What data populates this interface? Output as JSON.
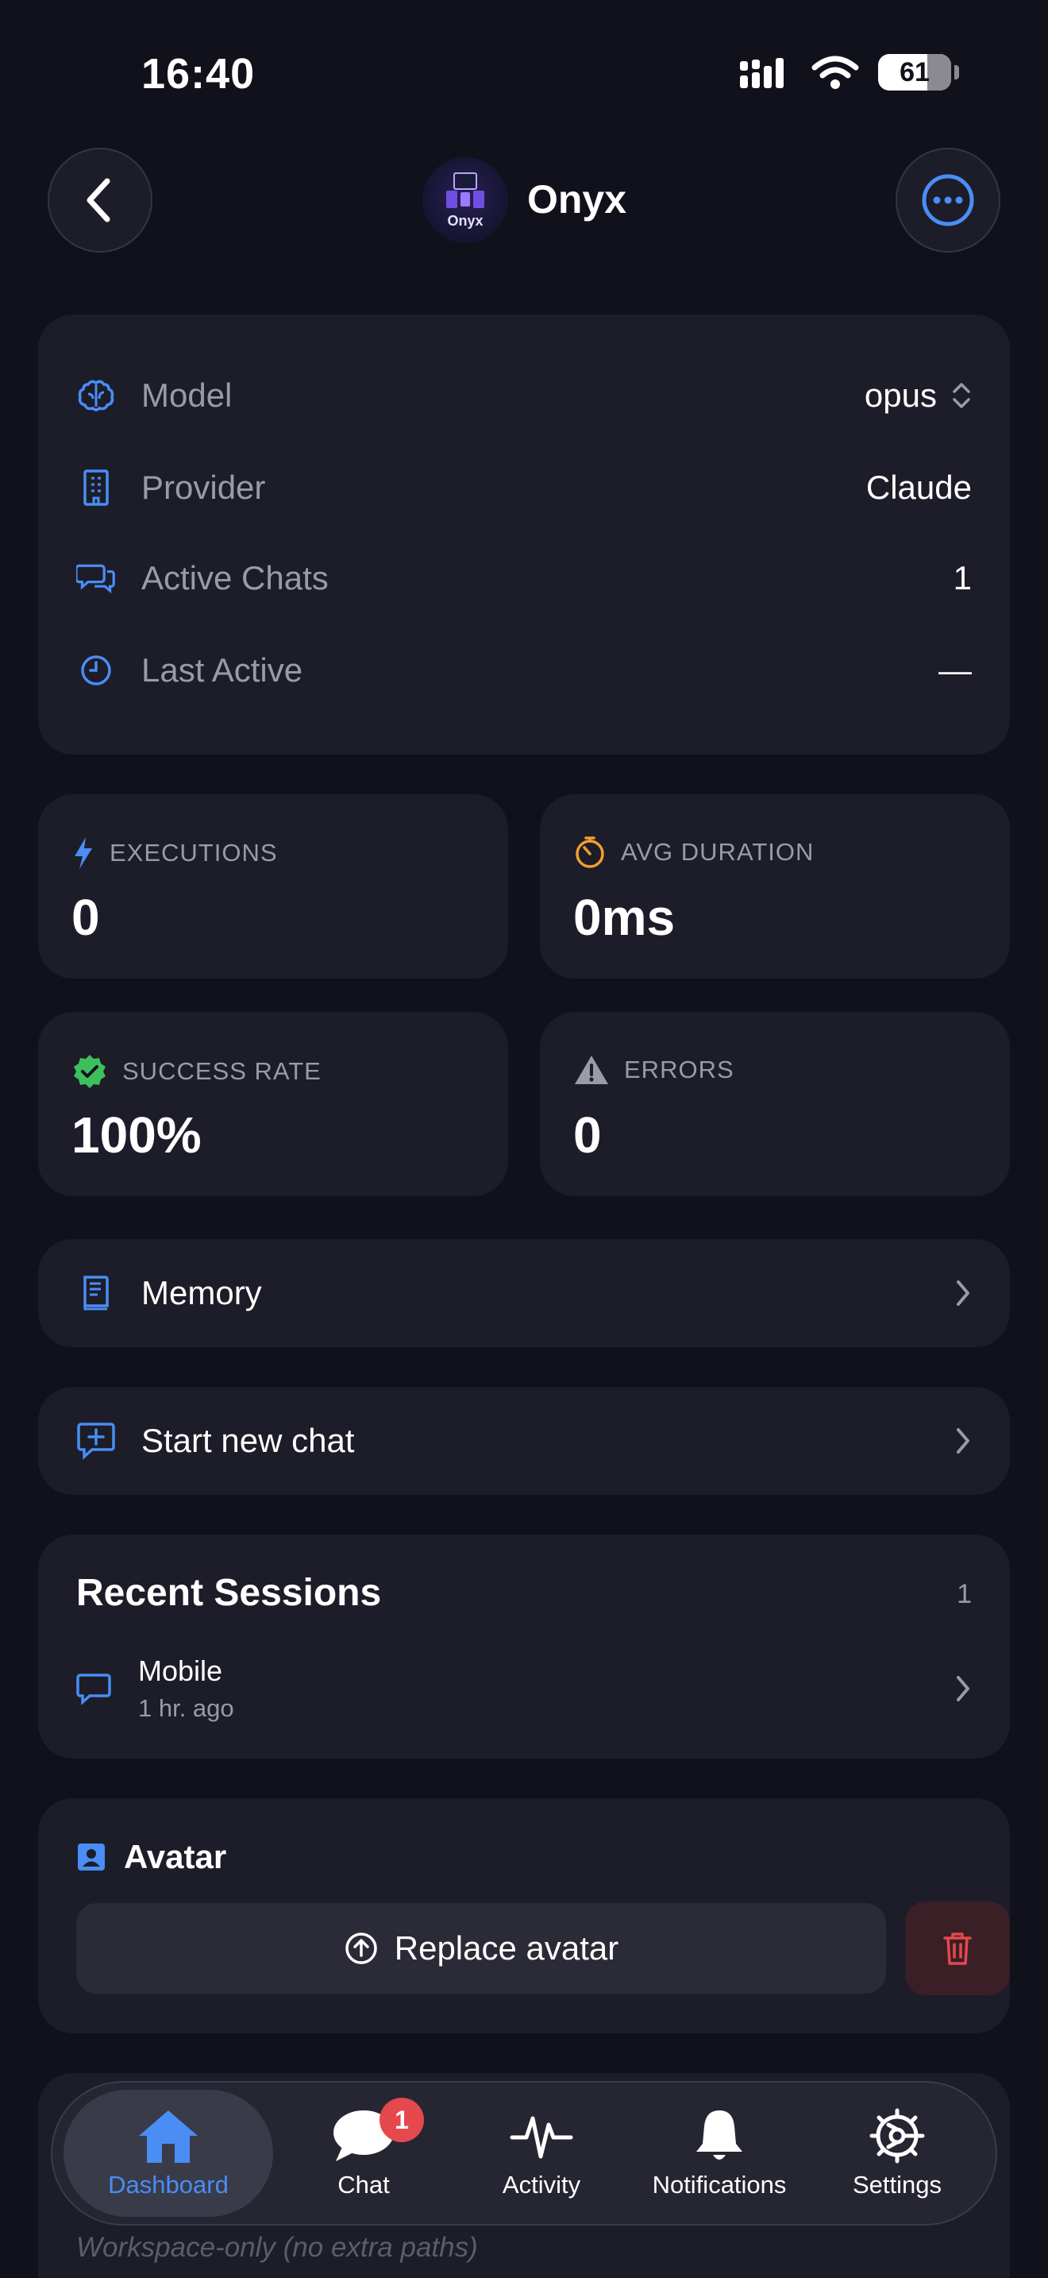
{
  "status_bar": {
    "time": "16:40",
    "battery": "61"
  },
  "header": {
    "avatar_label": "Onyx",
    "title": "Onyx"
  },
  "info": {
    "model_label": "Model",
    "model_value": "opus",
    "provider_label": "Provider",
    "provider_value": "Claude",
    "active_chats_label": "Active Chats",
    "active_chats_value": "1",
    "last_active_label": "Last Active",
    "last_active_value": "—"
  },
  "stats": {
    "executions_label": "EXECUTIONS",
    "executions_value": "0",
    "avg_duration_label": "AVG DURATION",
    "avg_duration_value": "0ms",
    "success_rate_label": "SUCCESS RATE",
    "success_rate_value": "100%",
    "errors_label": "ERRORS",
    "errors_value": "0"
  },
  "memory": {
    "label": "Memory"
  },
  "new_chat": {
    "label": "Start new chat"
  },
  "sessions": {
    "title": "Recent Sessions",
    "count": "1",
    "items": [
      {
        "name": "Mobile",
        "ago": "1 hr. ago"
      }
    ]
  },
  "avatar_section": {
    "title": "Avatar",
    "replace_label": "Replace avatar"
  },
  "workspace": {
    "subtitle": "Workspace-only (no extra paths)"
  },
  "tabs": [
    {
      "label": "Dashboard"
    },
    {
      "label": "Chat",
      "badge": "1"
    },
    {
      "label": "Activity"
    },
    {
      "label": "Notifications"
    },
    {
      "label": "Settings"
    }
  ],
  "colors": {
    "accent": "#4a8df5",
    "background": "#10111a",
    "card": "#1c1d28",
    "success": "#3dbf5c",
    "warning": "#f0a030",
    "danger": "#e5484d"
  }
}
